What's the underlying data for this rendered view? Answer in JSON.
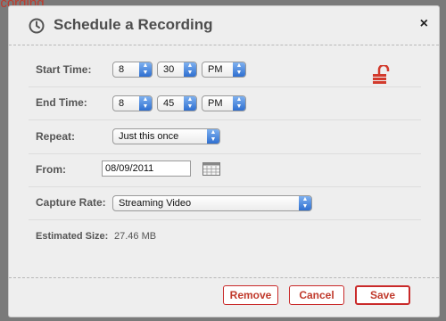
{
  "background": {
    "text": "ecording"
  },
  "dialog": {
    "title": "Schedule a Recording",
    "close_label": "×",
    "icons": [
      "clock-icon",
      "unlock-icon",
      "calendar-icon"
    ],
    "accent_color": "#c0392b"
  },
  "form": {
    "start_time": {
      "label": "Start Time:",
      "hour": "8",
      "minute": "30",
      "ampm": "PM"
    },
    "end_time": {
      "label": "End Time:",
      "hour": "8",
      "minute": "45",
      "ampm": "PM"
    },
    "repeat": {
      "label": "Repeat:",
      "value": "Just this once"
    },
    "from": {
      "label": "From:",
      "value": "08/09/2011"
    },
    "capture_rate": {
      "label": "Capture Rate:",
      "value": "Streaming Video"
    },
    "estimated_size": {
      "label": "Estimated Size:",
      "value": "27.46 MB"
    }
  },
  "buttons": {
    "remove": "Remove",
    "cancel": "Cancel",
    "save": "Save"
  }
}
